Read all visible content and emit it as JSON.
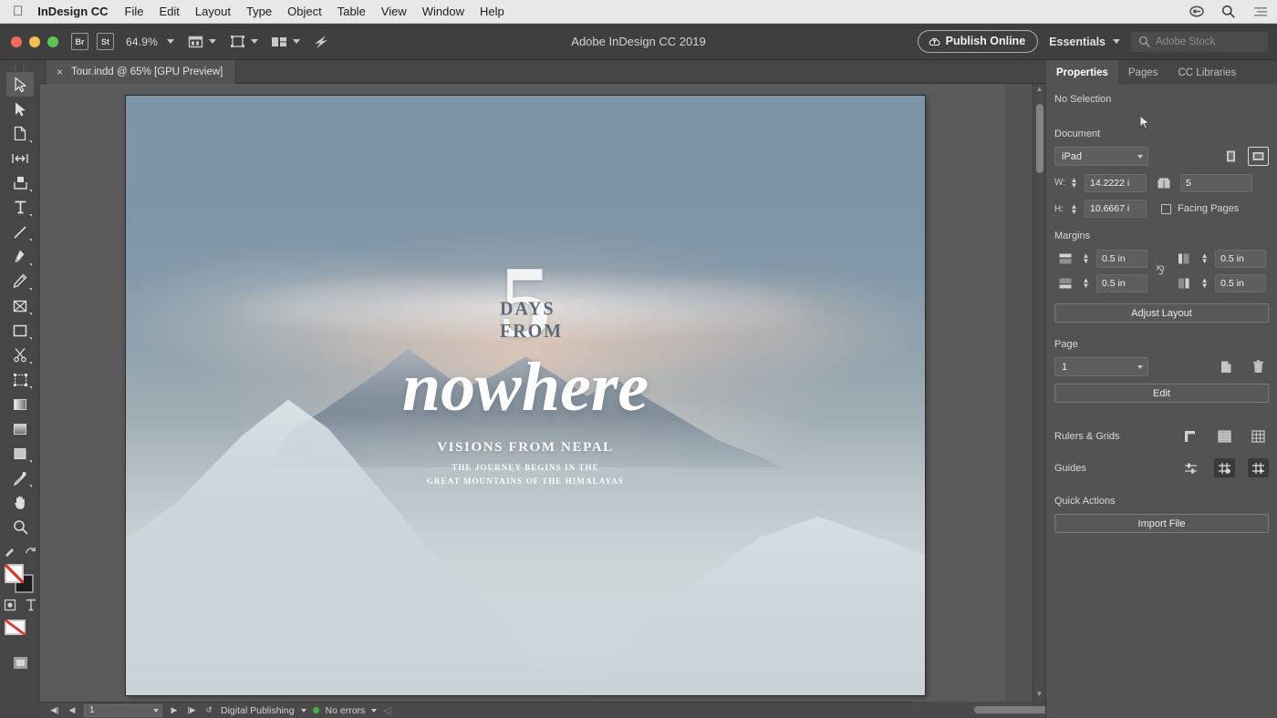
{
  "os_menu": {
    "apple": "apple-logo",
    "app": "InDesign CC",
    "items": [
      "File",
      "Edit",
      "Layout",
      "Type",
      "Object",
      "Table",
      "View",
      "Window",
      "Help"
    ],
    "right_icons": [
      "control-center-icon",
      "spotlight-search-icon",
      "notification-list-icon"
    ]
  },
  "titlebar": {
    "title": "Adobe InDesign CC 2019",
    "bridge_label": "Br",
    "stock_label": "St",
    "zoom_level": "64.9%",
    "publish_label": "Publish Online",
    "workspace": "Essentials",
    "search_placeholder": "Adobe Stock"
  },
  "document_tab": {
    "label": "Tour.indd @ 65% [GPU Preview]",
    "close": "×"
  },
  "tools": [
    {
      "name": "selection-tool",
      "active": true
    },
    {
      "name": "direct-selection-tool",
      "active": false
    },
    {
      "name": "page-tool",
      "active": false
    },
    {
      "name": "gap-tool",
      "active": false
    },
    {
      "name": "content-collector-tool",
      "active": false
    },
    {
      "name": "type-tool",
      "active": false
    },
    {
      "name": "line-tool",
      "active": false
    },
    {
      "name": "pen-tool",
      "active": false
    },
    {
      "name": "pencil-tool",
      "active": false
    },
    {
      "name": "frame-tool",
      "active": false
    },
    {
      "name": "rectangle-tool",
      "active": false
    },
    {
      "name": "scissors-tool",
      "active": false
    },
    {
      "name": "free-transform-tool",
      "active": false
    },
    {
      "name": "gradient-swatch-tool",
      "active": false
    },
    {
      "name": "gradient-feather-tool",
      "active": false
    },
    {
      "name": "note-tool",
      "active": false
    },
    {
      "name": "eyedropper-tool",
      "active": false
    },
    {
      "name": "hand-tool",
      "active": false
    },
    {
      "name": "zoom-tool",
      "active": false
    }
  ],
  "artboard": {
    "headline_number": "5",
    "headline_arc": "DAYS FROM",
    "headline_script": "nowhere",
    "subtitle": "VISIONS FROM NEPAL",
    "tagline_line1": "THE JOURNEY BEGINS IN THE",
    "tagline_line2": "GREAT MOUNTAINS OF THE HIMALAYAS"
  },
  "properties_panel": {
    "tabs": [
      {
        "label": "Properties",
        "active": true
      },
      {
        "label": "Pages",
        "active": false
      },
      {
        "label": "CC Libraries",
        "active": false
      }
    ],
    "selection_state": "No Selection",
    "document": {
      "title": "Document",
      "preset": "iPad",
      "orientation_portrait": "portrait-icon",
      "orientation_landscape": "landscape-icon",
      "width_label": "W:",
      "width_value": "14.2222 i",
      "height_label": "H:",
      "height_value": "10.6667 i",
      "pages_value": "5",
      "facing_pages_label": "Facing Pages",
      "facing_pages_checked": false
    },
    "margins": {
      "title": "Margins",
      "top": "0.5 in",
      "bottom": "0.5 in",
      "left": "0.5 in",
      "right": "0.5 in",
      "link_icon": "chain-link-icon"
    },
    "adjust_layout_label": "Adjust Layout",
    "page": {
      "title": "Page",
      "current": "1",
      "add_icon": "add-page-icon",
      "delete_icon": "trash-icon",
      "edit_label": "Edit"
    },
    "rulers_grids": {
      "title": "Rulers & Grids",
      "icons": [
        "show-rulers-icon",
        "baseline-grid-icon",
        "document-grid-icon"
      ]
    },
    "guides": {
      "title": "Guides",
      "icons": [
        "show-guides-icon",
        "lock-guides-icon",
        "smart-guides-icon"
      ]
    },
    "quick_actions": {
      "title": "Quick Actions",
      "import_label": "Import File"
    }
  },
  "statusbar": {
    "page_value": "1",
    "workspace_mode": "Digital Publishing",
    "preflight_status": "No errors",
    "first_icon": "first-page-icon",
    "prev_icon": "previous-page-icon",
    "next_icon": "next-page-icon",
    "last_icon": "last-page-icon"
  }
}
